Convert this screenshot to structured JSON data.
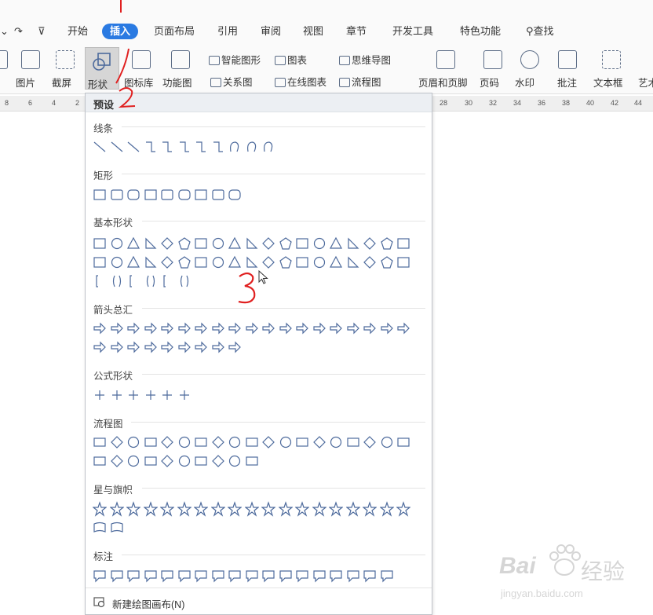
{
  "menu": {
    "items": [
      "开始",
      "插入",
      "页面布局",
      "引用",
      "审阅",
      "视图",
      "章节",
      "开发工具",
      "特色功能"
    ],
    "active": "插入",
    "search_label": "查找"
  },
  "ribbon": {
    "left_labels": [
      "图片",
      "截屏"
    ],
    "shape_label": "形状",
    "gallery_label": "图标库",
    "function_label": "功能图",
    "smart_shape": "智能图形",
    "chart": "图表",
    "mind_map": "思维导图",
    "relation": "关系图",
    "online_chart": "在线图表",
    "flowchart": "流程图",
    "header_footer": "页眉和页脚",
    "page_number": "页码",
    "watermark_label": "水印",
    "comment": "批注",
    "textbox": "文本框",
    "art": "艺术"
  },
  "ruler": {
    "left_ticks": [
      "8",
      "6",
      "4",
      "2"
    ],
    "right_ticks": [
      "28",
      "30",
      "32",
      "34",
      "36",
      "38",
      "40",
      "42",
      "44"
    ]
  },
  "dropdown": {
    "header": "预设",
    "categories": [
      {
        "label": "线条"
      },
      {
        "label": "矩形"
      },
      {
        "label": "基本形状"
      },
      {
        "label": "箭头总汇"
      },
      {
        "label": "公式形状"
      },
      {
        "label": "流程图"
      },
      {
        "label": "星与旗帜"
      },
      {
        "label": "标注"
      }
    ],
    "footer_label": "新建绘图画布(N)"
  },
  "annotations": [
    "1",
    "2",
    "3"
  ],
  "watermark": {
    "brand": "Bai",
    "brand2": "经验",
    "url": "jingyan.baidu.com"
  },
  "colors": {
    "accent": "#2a7ae2",
    "icon": "#4d6a9c",
    "annotation": "#e02020"
  }
}
